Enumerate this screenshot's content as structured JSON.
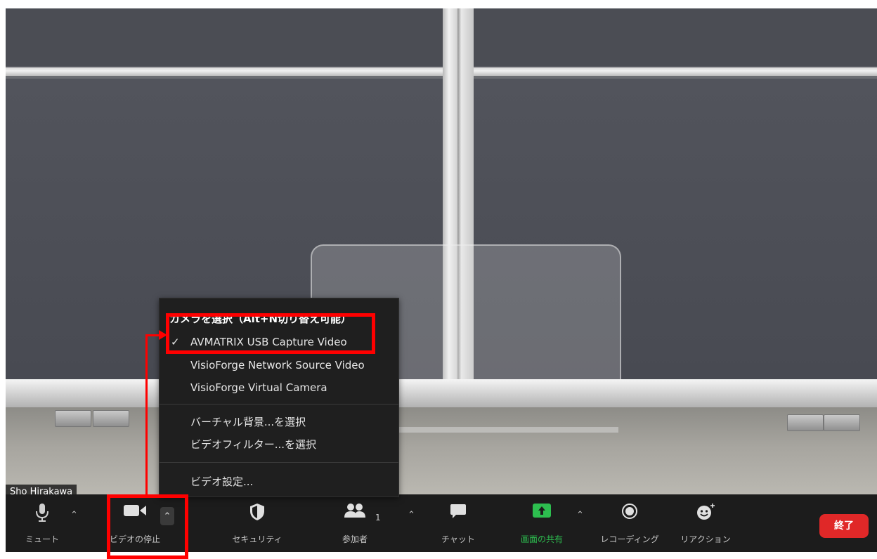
{
  "video": {
    "participant_name": "Sho Hirakawa"
  },
  "camera_menu": {
    "header": "カメラを選択（Alt+N切り替え可能）",
    "cameras": [
      {
        "label": "AVMATRIX USB Capture Video",
        "selected": true
      },
      {
        "label": "VisioForge Network Source Video",
        "selected": false
      },
      {
        "label": "VisioForge Virtual Camera",
        "selected": false
      }
    ],
    "check_mark": "✓",
    "background_option": "バーチャル背景...を選択",
    "filter_option": "ビデオフィルター...を選択",
    "settings_option": "ビデオ設定..."
  },
  "toolbar": {
    "mute_label": "ミュート",
    "video_label": "ビデオの停止",
    "security_label": "セキュリティ",
    "participants_label": "参加者",
    "participants_count": "1",
    "chat_label": "チャット",
    "share_label": "画面の共有",
    "record_label": "レコーディング",
    "reaction_label": "リアクション",
    "end_label": "終了",
    "icons": {
      "mute": "microphone-icon",
      "video": "video-camera-icon",
      "security": "shield-icon",
      "participants": "people-icon",
      "chat": "chat-bubble-icon",
      "share": "share-screen-icon",
      "record": "record-icon",
      "reaction": "smiley-icon"
    }
  },
  "colors": {
    "toolbar_bg": "#1c1c1c",
    "share_accent": "#2dbe4f",
    "end_button": "#e02828",
    "annotation": "#ff0000"
  }
}
